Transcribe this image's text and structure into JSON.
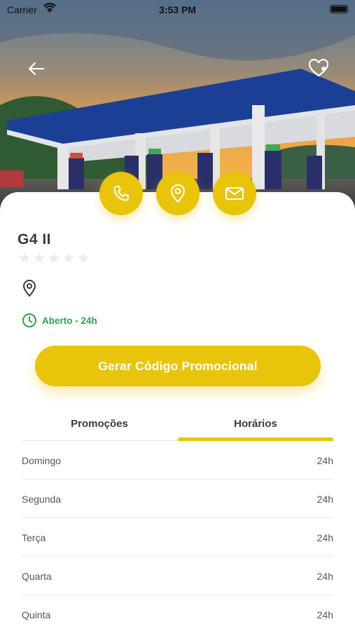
{
  "status_bar": {
    "carrier": "Carrier",
    "time": "3:53 PM"
  },
  "icons": {
    "back": "arrow-left-icon",
    "favorite": "heart-icon",
    "call": "phone-icon",
    "map": "map-pin-icon",
    "mail": "mail-icon",
    "location": "map-pin-icon",
    "clock": "clock-icon",
    "star": "star-icon"
  },
  "colors": {
    "accent": "#e8c40b",
    "open_status": "#2ba24c",
    "star_empty": "#ececec"
  },
  "station": {
    "name": "G4 II",
    "rating": 0,
    "rating_max": 5,
    "address": "",
    "open_status": "Aberto - 24h"
  },
  "promo_button": {
    "label": "Gerar Código Promocional"
  },
  "tabs": [
    {
      "label": "Promoções",
      "active": false
    },
    {
      "label": "Horários",
      "active": true
    }
  ],
  "hours": [
    {
      "day": "Domingo",
      "value": "24h"
    },
    {
      "day": "Segunda",
      "value": "24h"
    },
    {
      "day": "Terça",
      "value": "24h"
    },
    {
      "day": "Quarta",
      "value": "24h"
    },
    {
      "day": "Quinta",
      "value": "24h"
    }
  ]
}
